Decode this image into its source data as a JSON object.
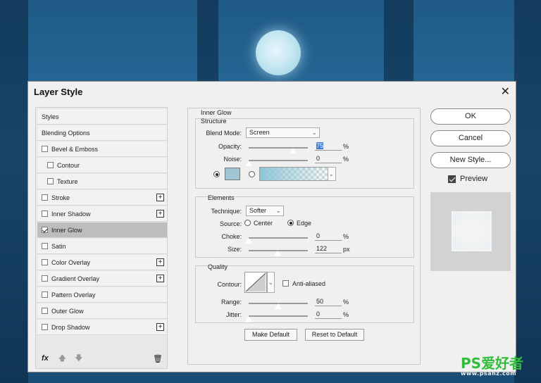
{
  "dialog": {
    "title": "Layer Style"
  },
  "styles_list": {
    "items": [
      {
        "label": "Styles",
        "has_checkbox": false,
        "checked": false,
        "has_plus": false,
        "selected": false,
        "indent": false
      },
      {
        "label": "Blending Options",
        "has_checkbox": false,
        "checked": false,
        "has_plus": false,
        "selected": false,
        "indent": false
      },
      {
        "label": "Bevel & Emboss",
        "has_checkbox": true,
        "checked": false,
        "has_plus": false,
        "selected": false,
        "indent": false
      },
      {
        "label": "Contour",
        "has_checkbox": true,
        "checked": false,
        "has_plus": false,
        "selected": false,
        "indent": true
      },
      {
        "label": "Texture",
        "has_checkbox": true,
        "checked": false,
        "has_plus": false,
        "selected": false,
        "indent": true
      },
      {
        "label": "Stroke",
        "has_checkbox": true,
        "checked": false,
        "has_plus": true,
        "selected": false,
        "indent": false
      },
      {
        "label": "Inner Shadow",
        "has_checkbox": true,
        "checked": false,
        "has_plus": true,
        "selected": false,
        "indent": false
      },
      {
        "label": "Inner Glow",
        "has_checkbox": true,
        "checked": true,
        "has_plus": false,
        "selected": true,
        "indent": false
      },
      {
        "label": "Satin",
        "has_checkbox": true,
        "checked": false,
        "has_plus": false,
        "selected": false,
        "indent": false
      },
      {
        "label": "Color Overlay",
        "has_checkbox": true,
        "checked": false,
        "has_plus": true,
        "selected": false,
        "indent": false
      },
      {
        "label": "Gradient Overlay",
        "has_checkbox": true,
        "checked": false,
        "has_plus": true,
        "selected": false,
        "indent": false
      },
      {
        "label": "Pattern Overlay",
        "has_checkbox": true,
        "checked": false,
        "has_plus": false,
        "selected": false,
        "indent": false
      },
      {
        "label": "Outer Glow",
        "has_checkbox": true,
        "checked": false,
        "has_plus": false,
        "selected": false,
        "indent": false
      },
      {
        "label": "Drop Shadow",
        "has_checkbox": true,
        "checked": false,
        "has_plus": true,
        "selected": false,
        "indent": false
      }
    ],
    "fx_label": "fx"
  },
  "inner_glow": {
    "panel_title": "Inner Glow",
    "structure": {
      "title": "Structure",
      "blend_mode_label": "Blend Mode:",
      "blend_mode_value": "Screen",
      "opacity_label": "Opacity:",
      "opacity_value": "75",
      "opacity_fraction": 0.75,
      "noise_label": "Noise:",
      "noise_value": "0",
      "noise_fraction": 0,
      "unit_percent": "%",
      "glow_color": "#9fc6d3"
    },
    "elements": {
      "title": "Elements",
      "technique_label": "Technique:",
      "technique_value": "Softer",
      "source_label": "Source:",
      "source_center": "Center",
      "source_edge": "Edge",
      "choke_label": "Choke:",
      "choke_value": "0",
      "choke_fraction": 0,
      "size_label": "Size:",
      "size_value": "122",
      "size_fraction": 0.49,
      "unit_px": "px"
    },
    "quality": {
      "title": "Quality",
      "contour_label": "Contour:",
      "anti_aliased_label": "Anti-aliased",
      "range_label": "Range:",
      "range_value": "50",
      "range_fraction": 0.5,
      "jitter_label": "Jitter:",
      "jitter_value": "0",
      "jitter_fraction": 0
    },
    "make_default": "Make Default",
    "reset_default": "Reset to Default"
  },
  "right": {
    "ok": "OK",
    "cancel": "Cancel",
    "new_style": "New Style...",
    "preview_label": "Preview"
  },
  "watermark": {
    "logo": "PS爱好者",
    "site": "www.psahz.com"
  }
}
